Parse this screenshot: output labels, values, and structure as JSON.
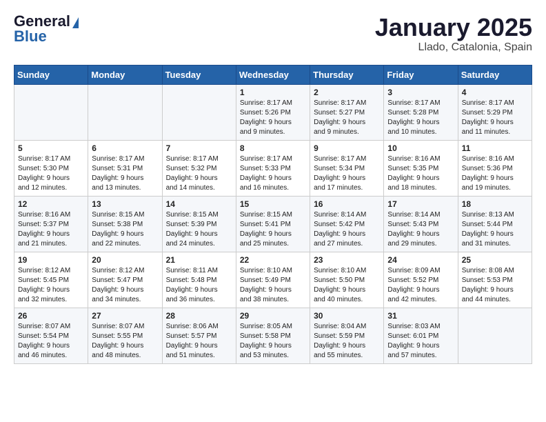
{
  "logo": {
    "general": "General",
    "blue": "Blue",
    "tagline": ""
  },
  "header": {
    "month": "January 2025",
    "location": "Llado, Catalonia, Spain"
  },
  "weekdays": [
    "Sunday",
    "Monday",
    "Tuesday",
    "Wednesday",
    "Thursday",
    "Friday",
    "Saturday"
  ],
  "weeks": [
    [
      {
        "day": "",
        "info": ""
      },
      {
        "day": "",
        "info": ""
      },
      {
        "day": "",
        "info": ""
      },
      {
        "day": "1",
        "info": "Sunrise: 8:17 AM\nSunset: 5:26 PM\nDaylight: 9 hours\nand 9 minutes."
      },
      {
        "day": "2",
        "info": "Sunrise: 8:17 AM\nSunset: 5:27 PM\nDaylight: 9 hours\nand 9 minutes."
      },
      {
        "day": "3",
        "info": "Sunrise: 8:17 AM\nSunset: 5:28 PM\nDaylight: 9 hours\nand 10 minutes."
      },
      {
        "day": "4",
        "info": "Sunrise: 8:17 AM\nSunset: 5:29 PM\nDaylight: 9 hours\nand 11 minutes."
      }
    ],
    [
      {
        "day": "5",
        "info": "Sunrise: 8:17 AM\nSunset: 5:30 PM\nDaylight: 9 hours\nand 12 minutes."
      },
      {
        "day": "6",
        "info": "Sunrise: 8:17 AM\nSunset: 5:31 PM\nDaylight: 9 hours\nand 13 minutes."
      },
      {
        "day": "7",
        "info": "Sunrise: 8:17 AM\nSunset: 5:32 PM\nDaylight: 9 hours\nand 14 minutes."
      },
      {
        "day": "8",
        "info": "Sunrise: 8:17 AM\nSunset: 5:33 PM\nDaylight: 9 hours\nand 16 minutes."
      },
      {
        "day": "9",
        "info": "Sunrise: 8:17 AM\nSunset: 5:34 PM\nDaylight: 9 hours\nand 17 minutes."
      },
      {
        "day": "10",
        "info": "Sunrise: 8:16 AM\nSunset: 5:35 PM\nDaylight: 9 hours\nand 18 minutes."
      },
      {
        "day": "11",
        "info": "Sunrise: 8:16 AM\nSunset: 5:36 PM\nDaylight: 9 hours\nand 19 minutes."
      }
    ],
    [
      {
        "day": "12",
        "info": "Sunrise: 8:16 AM\nSunset: 5:37 PM\nDaylight: 9 hours\nand 21 minutes."
      },
      {
        "day": "13",
        "info": "Sunrise: 8:15 AM\nSunset: 5:38 PM\nDaylight: 9 hours\nand 22 minutes."
      },
      {
        "day": "14",
        "info": "Sunrise: 8:15 AM\nSunset: 5:39 PM\nDaylight: 9 hours\nand 24 minutes."
      },
      {
        "day": "15",
        "info": "Sunrise: 8:15 AM\nSunset: 5:41 PM\nDaylight: 9 hours\nand 25 minutes."
      },
      {
        "day": "16",
        "info": "Sunrise: 8:14 AM\nSunset: 5:42 PM\nDaylight: 9 hours\nand 27 minutes."
      },
      {
        "day": "17",
        "info": "Sunrise: 8:14 AM\nSunset: 5:43 PM\nDaylight: 9 hours\nand 29 minutes."
      },
      {
        "day": "18",
        "info": "Sunrise: 8:13 AM\nSunset: 5:44 PM\nDaylight: 9 hours\nand 31 minutes."
      }
    ],
    [
      {
        "day": "19",
        "info": "Sunrise: 8:12 AM\nSunset: 5:45 PM\nDaylight: 9 hours\nand 32 minutes."
      },
      {
        "day": "20",
        "info": "Sunrise: 8:12 AM\nSunset: 5:47 PM\nDaylight: 9 hours\nand 34 minutes."
      },
      {
        "day": "21",
        "info": "Sunrise: 8:11 AM\nSunset: 5:48 PM\nDaylight: 9 hours\nand 36 minutes."
      },
      {
        "day": "22",
        "info": "Sunrise: 8:10 AM\nSunset: 5:49 PM\nDaylight: 9 hours\nand 38 minutes."
      },
      {
        "day": "23",
        "info": "Sunrise: 8:10 AM\nSunset: 5:50 PM\nDaylight: 9 hours\nand 40 minutes."
      },
      {
        "day": "24",
        "info": "Sunrise: 8:09 AM\nSunset: 5:52 PM\nDaylight: 9 hours\nand 42 minutes."
      },
      {
        "day": "25",
        "info": "Sunrise: 8:08 AM\nSunset: 5:53 PM\nDaylight: 9 hours\nand 44 minutes."
      }
    ],
    [
      {
        "day": "26",
        "info": "Sunrise: 8:07 AM\nSunset: 5:54 PM\nDaylight: 9 hours\nand 46 minutes."
      },
      {
        "day": "27",
        "info": "Sunrise: 8:07 AM\nSunset: 5:55 PM\nDaylight: 9 hours\nand 48 minutes."
      },
      {
        "day": "28",
        "info": "Sunrise: 8:06 AM\nSunset: 5:57 PM\nDaylight: 9 hours\nand 51 minutes."
      },
      {
        "day": "29",
        "info": "Sunrise: 8:05 AM\nSunset: 5:58 PM\nDaylight: 9 hours\nand 53 minutes."
      },
      {
        "day": "30",
        "info": "Sunrise: 8:04 AM\nSunset: 5:59 PM\nDaylight: 9 hours\nand 55 minutes."
      },
      {
        "day": "31",
        "info": "Sunrise: 8:03 AM\nSunset: 6:01 PM\nDaylight: 9 hours\nand 57 minutes."
      },
      {
        "day": "",
        "info": ""
      }
    ]
  ]
}
